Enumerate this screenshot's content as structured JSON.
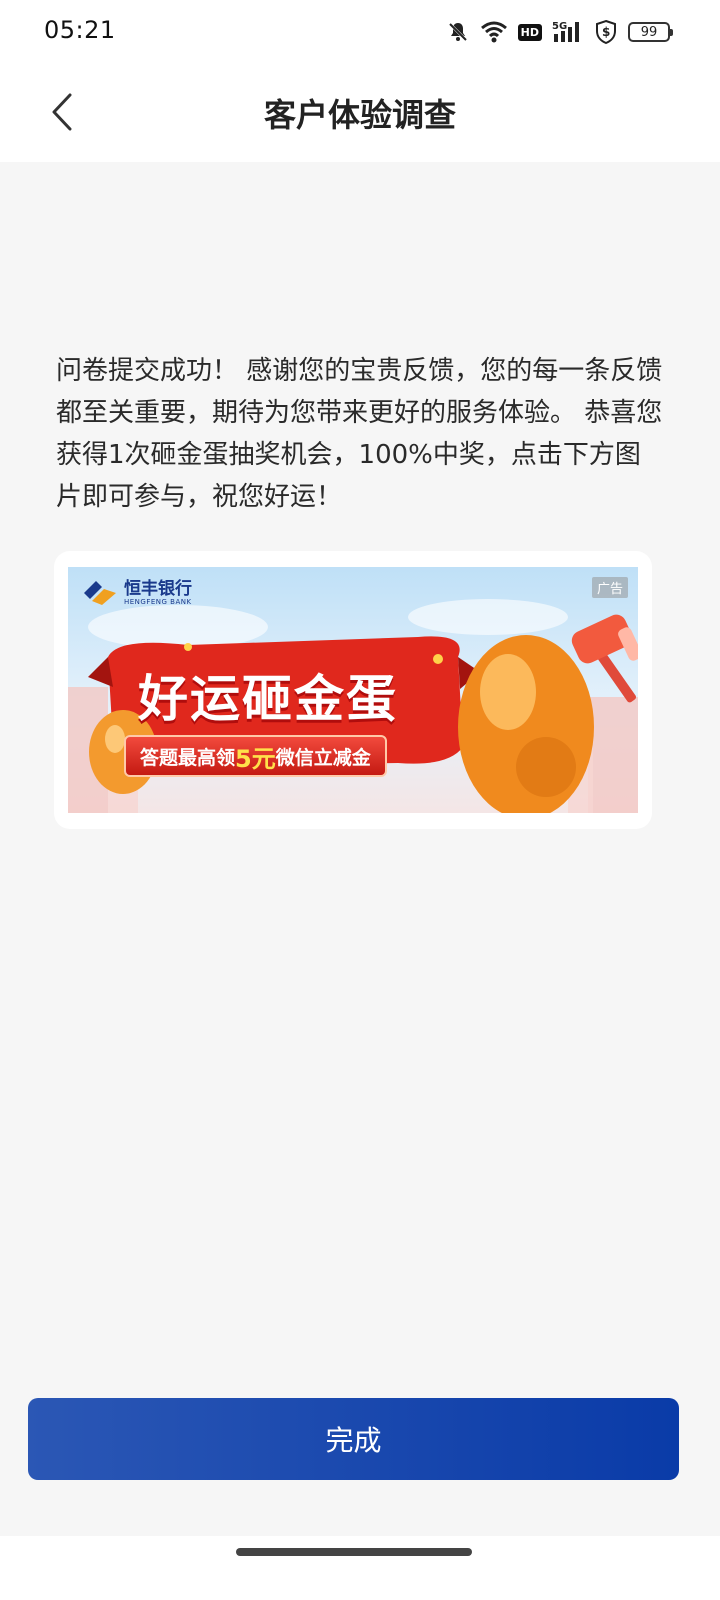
{
  "status_bar": {
    "time": "05:21",
    "hd": "HD",
    "network": "5G",
    "battery": "99",
    "icons": [
      "bell-off-icon",
      "wifi-icon",
      "hd-icon",
      "signal-5g-icon",
      "shield-dollar-icon",
      "battery-icon"
    ]
  },
  "nav": {
    "title": "客户体验调查",
    "back_icon": "chevron-left-icon"
  },
  "message": {
    "text": "问卷提交成功！ 感谢您的宝贵反馈，您的每一条反馈都至关重要，期待为您带来更好的服务体验。 恭喜您获得1次砸金蛋抽奖机会，100%中奖，点击下方图片即可参与，祝您好运！"
  },
  "ad": {
    "tag": "广告",
    "bank_name_cn": "恒丰银行",
    "bank_name_en": "HENGFENG BANK",
    "title": "好运砸金蛋",
    "subtitle_pre": "答题最高领",
    "subtitle_highlight": "5元",
    "subtitle_post": "微信立减金",
    "colors": {
      "red": "#e0281d",
      "gold": "#f39a2e",
      "highlight": "#ffe14a"
    }
  },
  "actions": {
    "done_label": "完成",
    "accent": "#0a3ba8"
  }
}
